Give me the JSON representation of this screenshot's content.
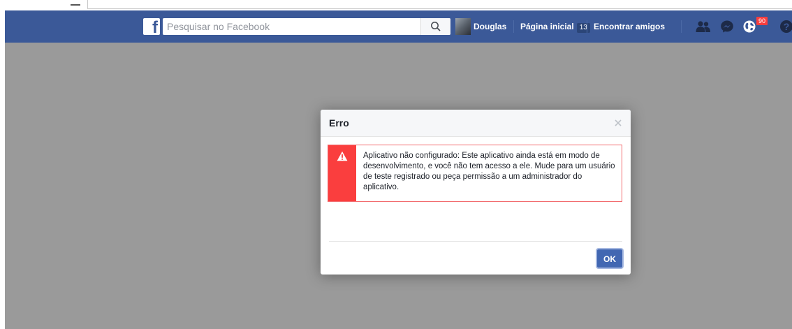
{
  "colors": {
    "fb_blue": "#3b5998",
    "error_red": "#fa3e3e",
    "overlay_grey": "#9a9a9a",
    "button_blue": "#4267b2"
  },
  "header": {
    "search_placeholder": "Pesquisar no Facebook",
    "profile_name": "Douglas",
    "home_label": "Página inicial",
    "home_count": "13",
    "find_friends_label": "Encontrar amigos",
    "notifications_count": "90",
    "icons": [
      "facebook-logo-icon",
      "search-icon",
      "friend-requests-icon",
      "messenger-icon",
      "notifications-globe-icon",
      "help-icon"
    ]
  },
  "dialog": {
    "title": "Erro",
    "message": "Aplicativo não configurado: Este aplicativo ainda está em modo de desenvolvimento, e você não tem acesso a ele. Mude para um usuário de teste registrado ou peça permissão a um administrador do aplicativo.",
    "ok_label": "OK",
    "icons": [
      "close-icon",
      "warning-icon"
    ]
  }
}
